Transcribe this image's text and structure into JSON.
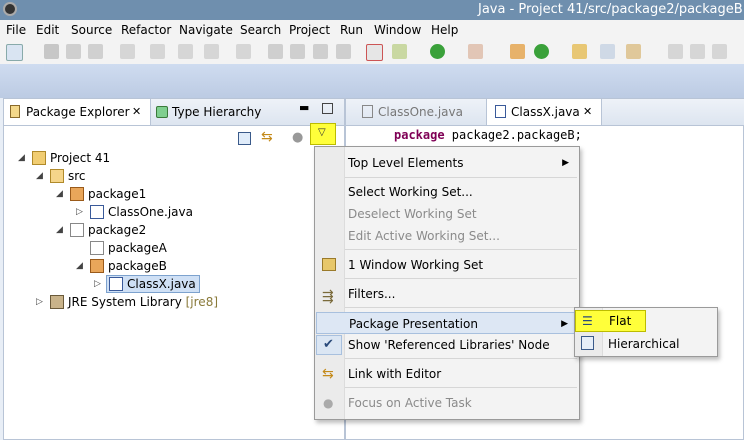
{
  "window": {
    "title": "Java - Project 41/src/package2/packageB"
  },
  "menubar": {
    "items": [
      "File",
      "Edit",
      "Source",
      "Refactor",
      "Navigate",
      "Search",
      "Project",
      "Run",
      "Window",
      "Help"
    ]
  },
  "views": {
    "package_explorer_tab": "Package Explorer",
    "type_hierarchy_tab": "Type Hierarchy"
  },
  "tree": {
    "project": "Project 41",
    "src": "src",
    "package1": "package1",
    "classone": "ClassOne.java",
    "package2": "package2",
    "packageA": "packageA",
    "packageB": "packageB",
    "classx": "ClassX.java",
    "jre": "JRE System Library",
    "jre_version": "[jre8]"
  },
  "editor": {
    "tabs": [
      "ClassOne.java",
      "ClassX.java"
    ],
    "code_keyword": "package",
    "code_rest": " package2.packageB;"
  },
  "view_menu": {
    "items": {
      "top_level": "Top Level Elements",
      "select_ws": "Select Working Set...",
      "deselect_ws": "Deselect Working Set",
      "edit_ws": "Edit Active Working Set...",
      "window_ws": "1 Window Working Set",
      "filters": "Filters...",
      "package_presentation": "Package Presentation",
      "show_ref_libs": "Show 'Referenced Libraries' Node",
      "link_editor": "Link with Editor",
      "focus_task": "Focus on Active Task"
    }
  },
  "submenu": {
    "flat": "Flat",
    "hierarchical": "Hierarchical"
  },
  "colors": {
    "highlight": "#ffff3a",
    "selection": "#cfe0f5",
    "keyword": "#7f0055"
  }
}
